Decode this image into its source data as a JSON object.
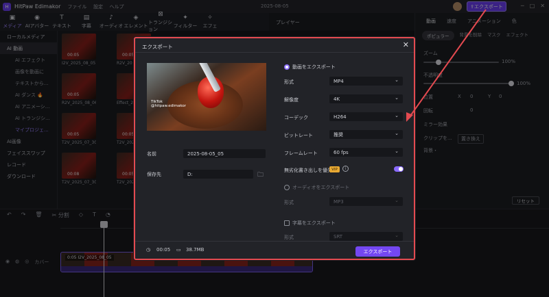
{
  "app": {
    "name": "HitPaw Edimakor",
    "menu": [
      "ファイル",
      "設定",
      "ヘルプ"
    ],
    "doc_title": "2025-08-05",
    "export_label": "エクスポート"
  },
  "toolbar": [
    {
      "label": "メディア",
      "icon": "folder-icon"
    },
    {
      "label": "AIアバター",
      "icon": "avatar-icon"
    },
    {
      "label": "テキスト",
      "icon": "text-icon"
    },
    {
      "label": "字幕",
      "icon": "caption-icon"
    },
    {
      "label": "オーディオ",
      "icon": "music-icon"
    },
    {
      "label": "エレメント",
      "icon": "element-icon"
    },
    {
      "label": "トランジション",
      "icon": "transition-icon"
    },
    {
      "label": "フィルター",
      "icon": "filter-icon"
    },
    {
      "label": "エフェ",
      "icon": "effect-icon"
    }
  ],
  "sidebar": [
    {
      "label": "ローカルメディア",
      "type": "main"
    },
    {
      "label": "AI 動画",
      "type": "active"
    },
    {
      "label": "AI エフェクト",
      "type": "sub"
    },
    {
      "label": "画像を動画に",
      "type": "sub"
    },
    {
      "label": "テキストから...",
      "type": "sub"
    },
    {
      "label": "AI ダンス 🔥",
      "type": "sub"
    },
    {
      "label": "AI アニメーシ...",
      "type": "sub"
    },
    {
      "label": "AI トランジシ...",
      "type": "sub"
    },
    {
      "label": "マイプロジェ...",
      "type": "purple"
    },
    {
      "label": "AI画像",
      "type": "main"
    },
    {
      "label": "フェイススワップ",
      "type": "main"
    },
    {
      "label": "レコード",
      "type": "main"
    },
    {
      "label": "ダウンロード",
      "type": "main"
    }
  ],
  "media": [
    {
      "duration": "00:05",
      "label": "I2V_2025_08_05"
    },
    {
      "duration": "00:05",
      "label": "R2V_20"
    },
    {
      "duration": "00:05",
      "label": "R2V_2025_08_06"
    },
    {
      "duration": "",
      "label": "Effect_2"
    },
    {
      "duration": "00:05",
      "label": "T2V_2025_07_30(10)"
    },
    {
      "duration": "00:05",
      "label": "T2V_202"
    },
    {
      "duration": "00:08",
      "label": "T2V_2025_07_30(9)"
    },
    {
      "duration": "00:05",
      "label": "T2V_202"
    }
  ],
  "player": {
    "label": "プレイヤー"
  },
  "right_panel": {
    "tabs": [
      "動画",
      "速度",
      "アニメーション",
      "色"
    ],
    "subtabs": [
      "ポピュラー",
      "背景を削除",
      "マスク",
      "エフェクト"
    ],
    "rows": [
      "ズーム",
      "不透明度",
      "位置",
      "回転",
      "ミラー効果",
      "クリップを...",
      "背景・"
    ],
    "zoom_value": "100%",
    "opacity_value": "100%",
    "x_label": "X",
    "x_value": "0",
    "y_label": "Y",
    "y_value": "0",
    "rotate_value": "0",
    "replace_label": "置き換え",
    "reset_label": "リセット"
  },
  "timeline": {
    "split_label": "分割",
    "track_label": "カバー",
    "clip_label": "0:05 I2V_2025_08_05"
  },
  "export_dialog": {
    "title": "エクスポート",
    "preview_watermark": "TikTok\n@hitpaw.edimakor",
    "name_label": "名前",
    "name_value": "2025-08-05_05",
    "save_label": "保存先",
    "save_value": "D:",
    "export_video_label": "動画をエクスポート",
    "format_label": "形式",
    "format_value": "MP4",
    "resolution_label": "解像度",
    "resolution_value": "4K",
    "codec_label": "コーデック",
    "codec_value": "H264",
    "bitrate_label": "ビットレート",
    "bitrate_value": "推奨",
    "framerate_label": "フレームレート",
    "framerate_value": "60  fps",
    "watermark_label": "無劣化書き出しを優先",
    "vip_badge": "VIP",
    "export_audio_label": "オーディオをエクスポート",
    "audio_format_label": "形式",
    "audio_format_value": "MP3",
    "export_subtitle_label": "字幕をエクスポート",
    "subtitle_format_label": "形式",
    "subtitle_format_value": "SRT",
    "duration": "00:05",
    "file_size": "38.7MB",
    "export_button": "エクスポート"
  },
  "colors": {
    "accent": "#7447f2",
    "annotation": "#e44a50"
  }
}
